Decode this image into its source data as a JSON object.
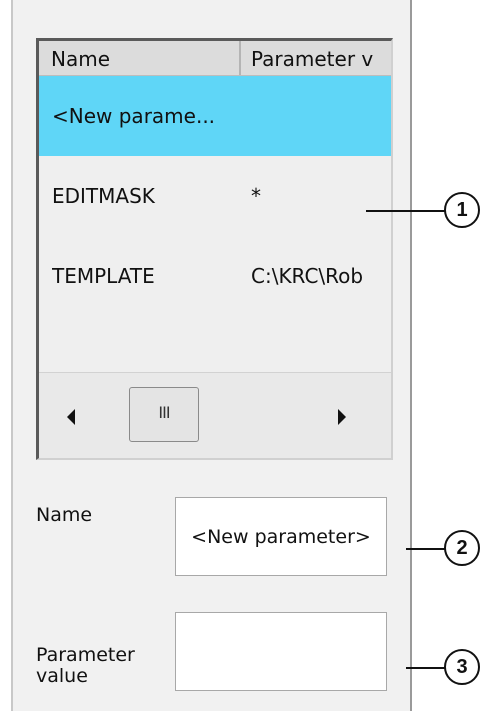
{
  "list": {
    "columns": [
      "Name",
      "Parameter v"
    ],
    "rows": [
      {
        "name": "<New parame...",
        "value": "",
        "selected": true
      },
      {
        "name": "EDITMASK",
        "value": "*",
        "selected": false
      },
      {
        "name": "TEMPLATE",
        "value": "C:\\KRC\\Rob",
        "selected": false
      }
    ],
    "scroll_thumb_glyph": "III"
  },
  "form": {
    "name_label": "Name",
    "name_value": "<New parameter>",
    "param_label_line1": "Parameter",
    "param_label_line2": "value",
    "param_value": ""
  },
  "callouts": [
    "1",
    "2",
    "3"
  ],
  "colors": {
    "selected_row": "#5fd6f7",
    "panel": "#f1f1f1"
  }
}
